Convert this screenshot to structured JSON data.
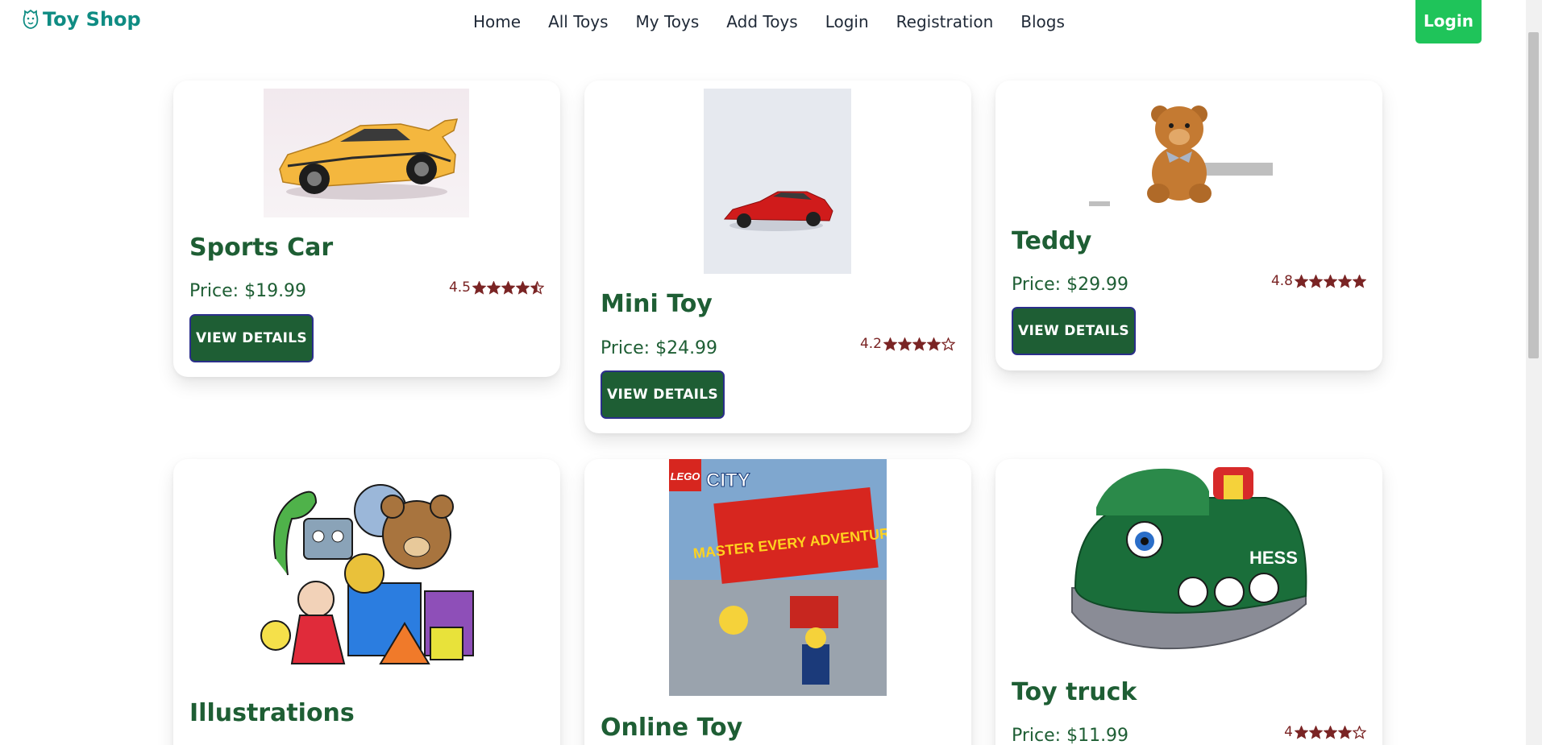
{
  "brand": {
    "name": "Toy Shop",
    "icon": "toy-shop-logo-icon"
  },
  "nav": [
    {
      "label": "Home"
    },
    {
      "label": "All Toys"
    },
    {
      "label": "My Toys"
    },
    {
      "label": "Add Toys"
    },
    {
      "label": "Login"
    },
    {
      "label": "Registration"
    },
    {
      "label": "Blogs"
    }
  ],
  "header_login_label": "Login",
  "details_label": "VIEW DETAILS",
  "colors": {
    "brand": "#0f8c83",
    "accent_green": "#1e5e34",
    "login_bg": "#1fc45a",
    "rating": "#7a2424"
  },
  "cards": [
    {
      "title": "Sports Car",
      "price": "Price: $19.99",
      "rating_text": "4.5",
      "rating": 4.5,
      "image": "yellow-sports-car"
    },
    {
      "title": "Mini Toy",
      "price": "Price: $24.99",
      "rating_text": "4.2",
      "rating": 4.2,
      "image": "red-mini-car"
    },
    {
      "title": "Teddy",
      "price": "Price: $29.99",
      "rating_text": "4.8",
      "rating": 4.8,
      "image": "teddy-bear"
    },
    {
      "title": "Illustrations",
      "image": "toys-illustration"
    },
    {
      "title": "Online Toy",
      "image": "lego-city-box",
      "image_text": {
        "brand": "LEGO",
        "line": "CITY",
        "headline": "MASTER EVERY ADVENTURE"
      }
    },
    {
      "title": "Toy truck",
      "price": "Price: $11.99",
      "rating_text": "4",
      "rating": 4,
      "image": "plush-boat",
      "image_text": "HESS"
    }
  ]
}
